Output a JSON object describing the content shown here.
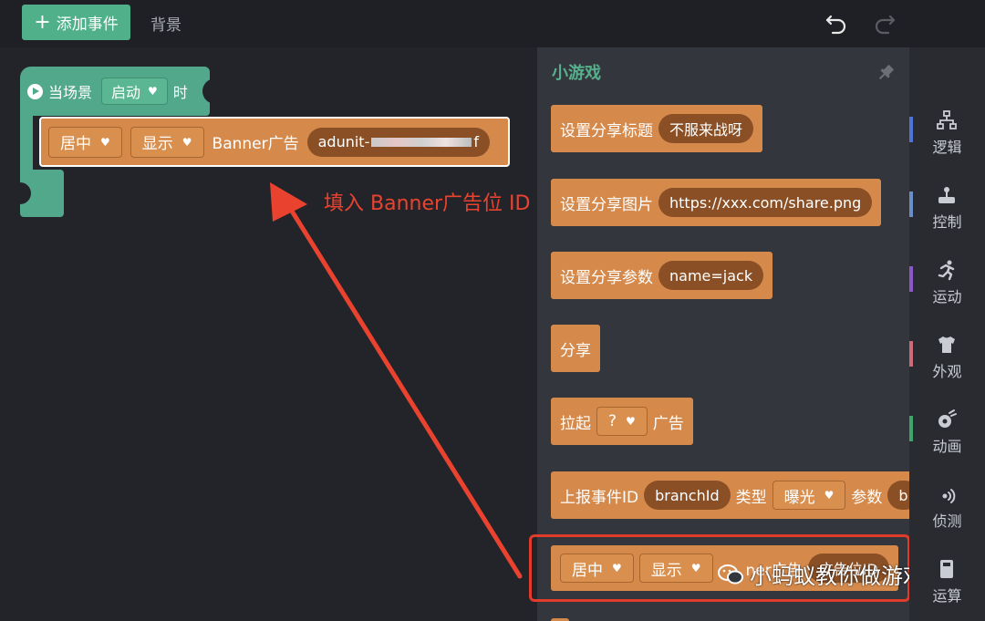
{
  "topbar": {
    "add_event_label": "添加事件",
    "background_tab": "背景"
  },
  "workspace": {
    "hat_block": {
      "when_scene": "当场景",
      "trigger": "启动",
      "suffix": "时"
    },
    "banner_block": {
      "position": "居中",
      "action": "显示",
      "label": "Banner广告",
      "ad_unit_prefix": "adunit-",
      "ad_unit_suffix": "f"
    }
  },
  "annotation": {
    "text": "填入 Banner广告位 ID",
    "color": "#e9432f"
  },
  "flyout": {
    "title": "小游戏",
    "blocks": [
      {
        "label": "设置分享标题",
        "value": "不服来战呀"
      },
      {
        "label": "设置分享图片",
        "value": "https://xxx.com/share.png"
      },
      {
        "label": "设置分享参数",
        "value": "name=jack"
      },
      {
        "label": "分享"
      },
      {
        "label": "拉起",
        "dropdown": "?",
        "suffix": "广告"
      },
      {
        "label": "上报事件ID",
        "value": "branchId",
        "type_label": "类型",
        "type_value": "曝光",
        "param_label": "参数",
        "param_value": "b"
      },
      {
        "position": "居中",
        "action": "显示",
        "label": "ner广告",
        "value": "广告位ID"
      }
    ]
  },
  "categories": [
    {
      "label": "逻辑",
      "icon": "hierarchy-icon",
      "color": "#4d74d6"
    },
    {
      "label": "控制",
      "icon": "control-icon",
      "color": "#6a8fc8"
    },
    {
      "label": "运动",
      "icon": "runner-icon",
      "color": "#8b57c9"
    },
    {
      "label": "外观",
      "icon": "shirt-icon",
      "color": "#d06a7a"
    },
    {
      "label": "动画",
      "icon": "animation-icon",
      "color": "#3fa66a"
    },
    {
      "label": "侦测",
      "icon": "signal-icon",
      "color": "#3a3c44"
    },
    {
      "label": "运算",
      "icon": "calculator-icon",
      "color": "#3a3c44"
    }
  ],
  "watermark": {
    "text": "小蚂蚁教你做游戏",
    "icon": "wechat-icon"
  },
  "colors": {
    "green": "#52a88a",
    "orange": "#d58a4c",
    "highlight": "#e03b2b"
  }
}
